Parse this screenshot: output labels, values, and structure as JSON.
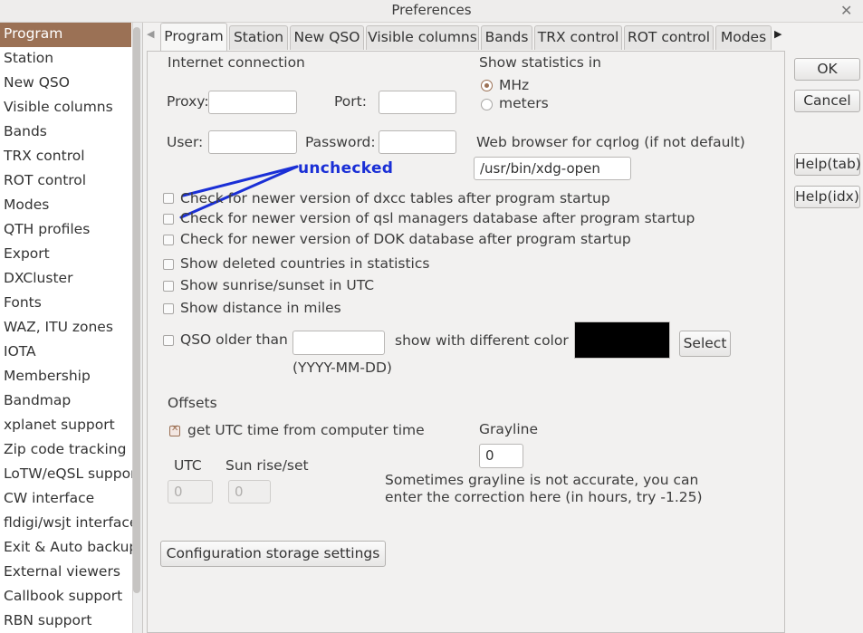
{
  "window": {
    "title": "Preferences",
    "close_label": "✕"
  },
  "sidebar": {
    "items": [
      {
        "label": "Program",
        "active": true
      },
      {
        "label": "Station"
      },
      {
        "label": "New QSO"
      },
      {
        "label": "Visible columns"
      },
      {
        "label": "Bands"
      },
      {
        "label": "TRX control"
      },
      {
        "label": "ROT control"
      },
      {
        "label": "Modes"
      },
      {
        "label": "QTH profiles"
      },
      {
        "label": "Export"
      },
      {
        "label": "DXCluster"
      },
      {
        "label": "Fonts"
      },
      {
        "label": "WAZ, ITU zones"
      },
      {
        "label": "IOTA"
      },
      {
        "label": "Membership"
      },
      {
        "label": "Bandmap"
      },
      {
        "label": "xplanet support"
      },
      {
        "label": "Zip code tracking"
      },
      {
        "label": "LoTW/eQSL support"
      },
      {
        "label": "CW interface"
      },
      {
        "label": "fldigi/wsjt interface"
      },
      {
        "label": "Exit & Auto backup"
      },
      {
        "label": "External viewers"
      },
      {
        "label": "Callbook support"
      },
      {
        "label": "RBN support"
      }
    ]
  },
  "tabs": {
    "left_arrow": "◀",
    "right_arrow": "▶",
    "items": [
      "Program",
      "Station",
      "New QSO",
      "Visible columns",
      "Bands",
      "TRX control",
      "ROT control",
      "Modes"
    ]
  },
  "program": {
    "internet_connection": "Internet connection",
    "proxy_label": "Proxy:",
    "proxy_value": "",
    "port_label": "Port:",
    "port_value": "",
    "user_label": "User:",
    "user_value": "",
    "password_label": "Password:",
    "password_value": "",
    "show_statistics_in": "Show statistics in",
    "units": [
      {
        "label": "MHz",
        "selected": true
      },
      {
        "label": "meters",
        "selected": false
      }
    ],
    "web_browser_label": "Web browser for cqrlog (if not default)",
    "web_browser_value": "/usr/bin/xdg-open",
    "annotation_text": "unchecked",
    "checks": [
      {
        "label": "Check for newer version of dxcc tables after program startup",
        "checked": false
      },
      {
        "label": "Check for newer version of qsl managers database  after program startup",
        "checked": false
      },
      {
        "label": "Check for newer version of DOK database  after program startup",
        "checked": false
      },
      {
        "label": "Show deleted countries in statistics",
        "checked": false
      },
      {
        "label": "Show sunrise/sunset in UTC",
        "checked": false
      },
      {
        "label": "Show distance in miles",
        "checked": false
      }
    ],
    "qso_older_label": "QSO older than",
    "qso_older_checked": false,
    "qso_older_value": "",
    "date_hint": "(YYYY-MM-DD)",
    "show_diff_color_label": "show with different color",
    "diff_color": "#000000",
    "select_button": "Select",
    "offsets_label": "Offsets",
    "utc_from_computer_label": "get UTC time from computer time",
    "utc_from_computer_checked": true,
    "utc_label": "UTC",
    "utc_value": "0",
    "sun_rise_set_label": "Sun rise/set",
    "sun_rise_set_value": "0",
    "grayline_label": "Grayline",
    "grayline_value": "0",
    "grayline_note_1": "Sometimes grayline is not accurate, you can",
    "grayline_note_2": "enter the correction here (in hours, try -1.25)",
    "config_storage_button": "Configuration storage settings"
  },
  "actions": {
    "ok": "OK",
    "cancel": "Cancel",
    "help_tab": "Help(tab)",
    "help_idx": "Help(idx)"
  },
  "colors": {
    "accent": "#9b7155",
    "annotation": "#1a2fd6"
  }
}
